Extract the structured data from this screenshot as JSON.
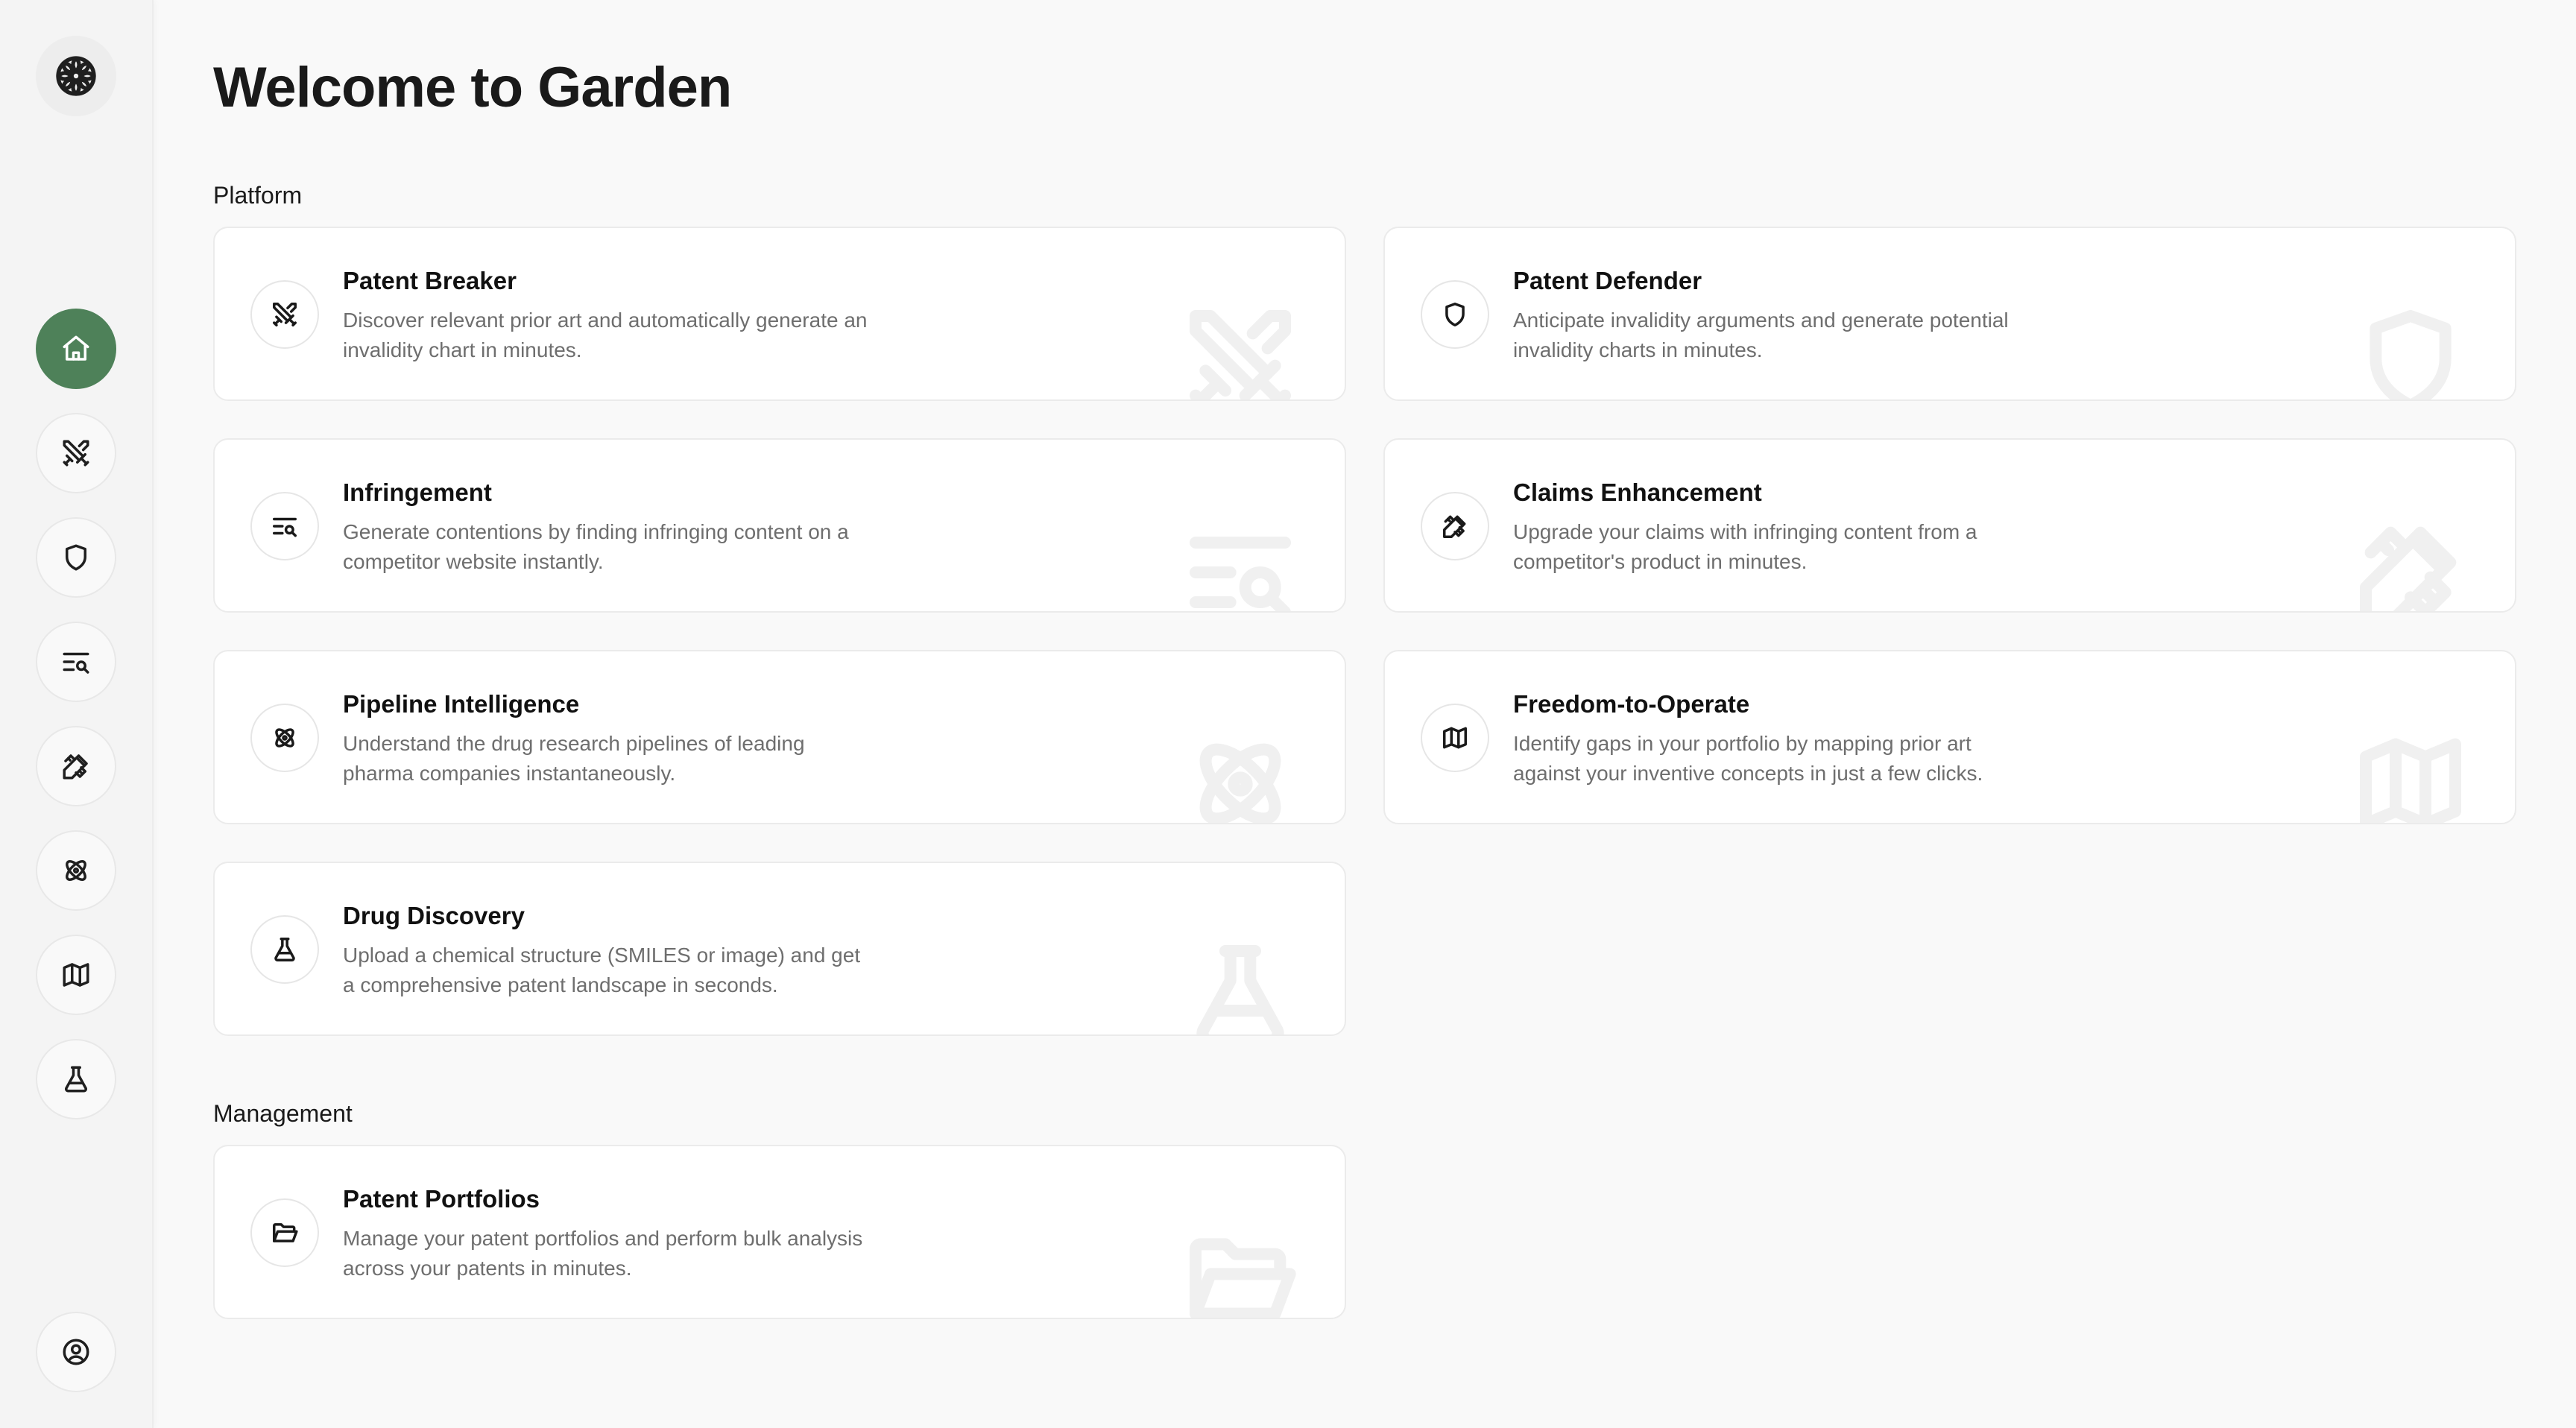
{
  "sidebar": {
    "logo_icon": "flower-logo-icon",
    "items": [
      {
        "name": "home",
        "icon": "home-icon",
        "active": true
      },
      {
        "name": "patent-breaker",
        "icon": "crossed-swords-icon"
      },
      {
        "name": "patent-defender",
        "icon": "shield-icon"
      },
      {
        "name": "infringement",
        "icon": "text-search-icon"
      },
      {
        "name": "claims-enhancement",
        "icon": "pencil-ruler-icon"
      },
      {
        "name": "pipeline-intelligence",
        "icon": "atom-icon"
      },
      {
        "name": "freedom-to-operate",
        "icon": "map-icon"
      },
      {
        "name": "drug-discovery",
        "icon": "flask-icon"
      }
    ],
    "account_icon": "user-circle-icon",
    "accent_color": "#4e8159"
  },
  "header": {
    "title": "Welcome to Garden"
  },
  "sections": {
    "platform": {
      "label": "Platform",
      "cards": [
        {
          "title": "Patent Breaker",
          "desc_line1": "Discover relevant prior art and automatically generate an",
          "desc_line2": "invalidity chart in minutes.",
          "icon": "crossed-swords-icon"
        },
        {
          "title": "Patent Defender",
          "desc_line1": "Anticipate invalidity arguments and generate potential",
          "desc_line2": "invalidity charts in minutes.",
          "icon": "shield-icon"
        },
        {
          "title": "Infringement",
          "desc_line1": "Generate contentions by finding infringing content on a",
          "desc_line2": "competitor website instantly.",
          "icon": "text-search-icon"
        },
        {
          "title": "Claims Enhancement",
          "desc_line1": "Upgrade your claims with infringing content from a",
          "desc_line2": "competitor's product in minutes.",
          "icon": "pencil-ruler-icon"
        },
        {
          "title": "Pipeline Intelligence",
          "desc_line1": "Understand the drug research pipelines of leading",
          "desc_line2": "pharma companies instantaneously.",
          "icon": "atom-icon"
        },
        {
          "title": "Freedom-to-Operate",
          "desc_line1": "Identify gaps in your portfolio by mapping prior art",
          "desc_line2": "against your inventive concepts in just a few clicks.",
          "icon": "map-icon"
        },
        {
          "title": "Drug Discovery",
          "desc_line1": "Upload a chemical structure (SMILES or image) and get",
          "desc_line2": "a comprehensive patent landscape in seconds.",
          "icon": "flask-icon"
        }
      ]
    },
    "management": {
      "label": "Management",
      "cards": [
        {
          "title": "Patent Portfolios",
          "desc_line1": "Manage your patent portfolios and perform bulk analysis",
          "desc_line2": "across your patents in minutes.",
          "icon": "folder-open-icon"
        }
      ]
    }
  }
}
